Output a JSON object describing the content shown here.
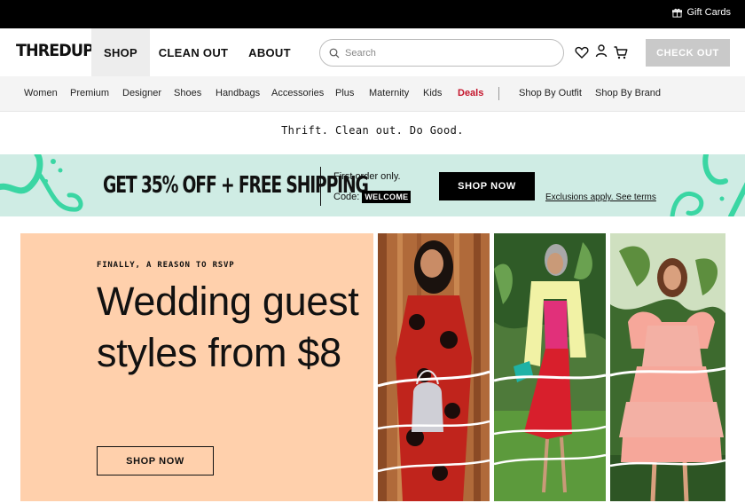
{
  "top_bar": {
    "gift_cards": "Gift Cards",
    "gift_icon": "gift-icon"
  },
  "header": {
    "logo": "THREDUP",
    "tabs": [
      {
        "label": "SHOP",
        "active": true
      },
      {
        "label": "CLEAN OUT",
        "active": false
      },
      {
        "label": "ABOUT",
        "active": false
      }
    ],
    "search": {
      "placeholder": "Search",
      "value": "",
      "icon": "search-icon"
    },
    "icons": [
      "heart-icon",
      "user-icon",
      "cart-icon"
    ],
    "checkout_label": "CHECK OUT"
  },
  "categories": {
    "items": [
      "Women",
      "Premium",
      "Designer",
      "Shoes",
      "Handbags",
      "Accessories",
      "Plus",
      "Maternity",
      "Kids",
      "Deals"
    ],
    "extra": [
      "Shop By Outfit",
      "Shop By Brand"
    ]
  },
  "tagline": "Thrift. Clean out. Do Good.",
  "promo": {
    "headline": "GET 35% OFF + FREE SHIPPING",
    "first_order": "First order only.",
    "code_label": "Code:",
    "code": "WELCOME",
    "shop_now": "SHOP NOW",
    "terms": "Exclusions apply. See terms"
  },
  "hero": {
    "eyebrow": "FINALLY, A REASON TO RSVP",
    "title": "Wedding guest styles from $8",
    "shop_now": "SHOP NOW"
  },
  "colors": {
    "accent_green": "#3ad6a3",
    "promo_bg": "#cfece4",
    "hero_bg": "#ffd0ac",
    "deals_red": "#c4142b"
  }
}
